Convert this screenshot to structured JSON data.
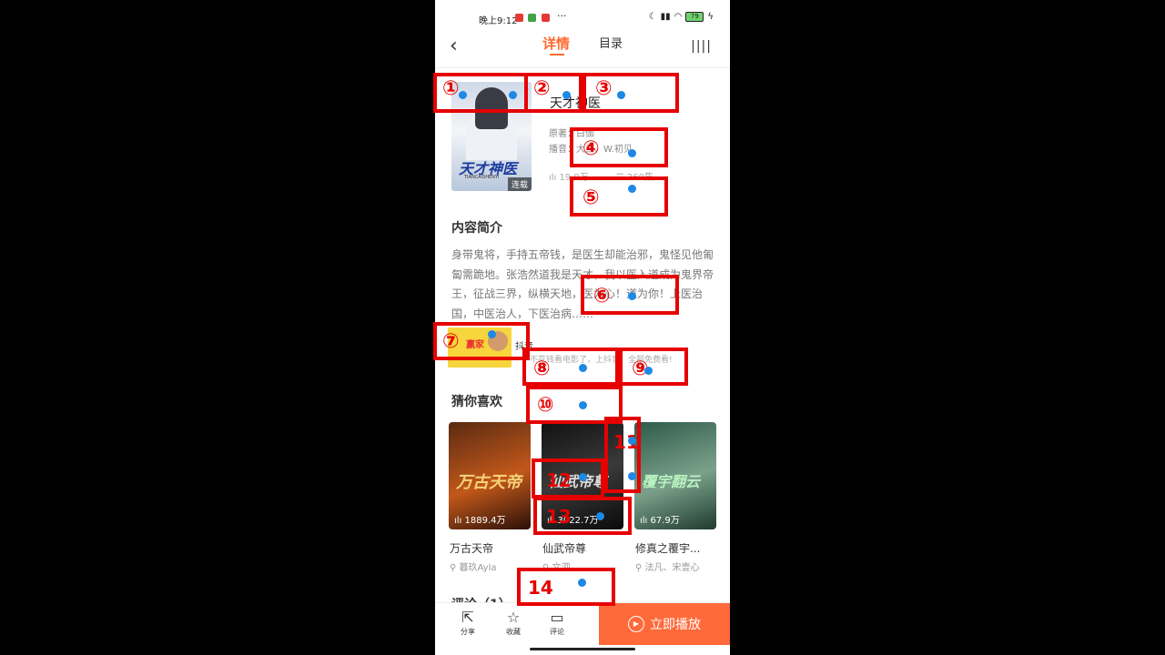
{
  "status_bar": {
    "time": "晚上9:12",
    "more": "···",
    "battery": "79"
  },
  "nav": {
    "back_icon": "chevron-left-icon",
    "tab_detail": "详情",
    "tab_catalog": "目录",
    "menu_icon": "bars-icon",
    "accent": "#ff6a2f"
  },
  "book": {
    "title": "天才神医",
    "cover_title": "天才神医",
    "cover_sub": "TIANCAISHENYI",
    "badge": "连载",
    "author_label": "原著：白伽",
    "narrator_label": "播音：大兰、W.初见",
    "plays": "19.9万",
    "episodes": "260集"
  },
  "summary": {
    "heading": "内容简介",
    "text": "身带鬼将，手持五帝钱，是医生却能治邪，鬼怪见他匍匐需跪地。张浩然道我是天才，我以医入道成为鬼界帝王，征战三界，纵横天地，医为心！道为你！上医治国，中医治人，下医治病……"
  },
  "ad": {
    "thumb_text": "赢家",
    "title": "抖音",
    "desc": "不花钱看电影了，上抖音，全部免费看!"
  },
  "recommend": {
    "heading": "猜你喜欢",
    "items": [
      {
        "name": "万古天帝",
        "author": "暮玖Ayla",
        "count": "1889.4万",
        "art": "万古天帝"
      },
      {
        "name": "仙武帝尊",
        "author": "文泗",
        "count": "3022.7万",
        "art": "仙武帝尊"
      },
      {
        "name": "修真之覆宇...",
        "author": "法凡、宋壹心",
        "count": "67.9万",
        "art": "覆宇翻云"
      }
    ]
  },
  "comments_peek": "评论（1）",
  "bottom_bar": {
    "share": "分享",
    "favorite": "收藏",
    "comment": "评论",
    "play": "立即播放"
  },
  "annotations": [
    "①",
    "②",
    "③",
    "④",
    "⑤",
    "⑥",
    "⑦",
    "⑧",
    "⑨",
    "⑩",
    "11",
    "12",
    "13",
    "14"
  ]
}
